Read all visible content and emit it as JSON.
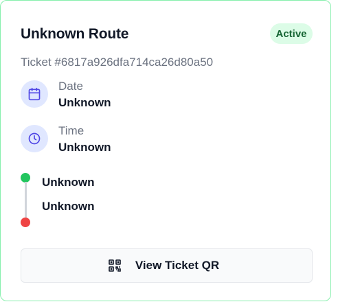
{
  "ticket": {
    "route_title": "Unknown Route",
    "status": "Active",
    "ticket_number": "Ticket #6817a926dfa714ca26d80a50"
  },
  "details": {
    "date_label": "Date",
    "date_value": "Unknown",
    "time_label": "Time",
    "time_value": "Unknown"
  },
  "route": {
    "from": "Unknown",
    "to": "Unknown"
  },
  "actions": {
    "view_qr_label": "View Ticket QR"
  },
  "colors": {
    "card_border": "#86efac",
    "badge_bg": "#dcfce7",
    "badge_text": "#166534",
    "icon_bg": "#e0e7ff",
    "icon_stroke": "#4f46e5",
    "start_dot": "#22c55e",
    "end_dot": "#ef4444"
  },
  "icons": {
    "date": "calendar-icon",
    "time": "clock-icon",
    "qr": "qr-code-icon"
  }
}
